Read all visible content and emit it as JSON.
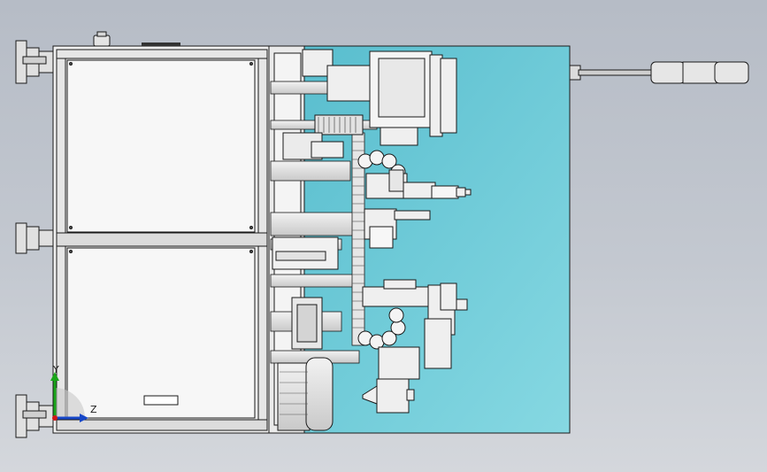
{
  "viewport": {
    "background_top": "#b6bcc6",
    "background_bottom": "#d4d7dc",
    "panel_color": "#6ec8d8",
    "line_color": "#1a1a1a",
    "part_color": "#e4e4e4"
  },
  "triad": {
    "y_label": "Y",
    "z_label": "Z",
    "y_color": "#1aa51a",
    "z_color": "#1747c8",
    "x_color": "#d01818"
  },
  "icons": {
    "triad": "axis-triad-icon"
  }
}
